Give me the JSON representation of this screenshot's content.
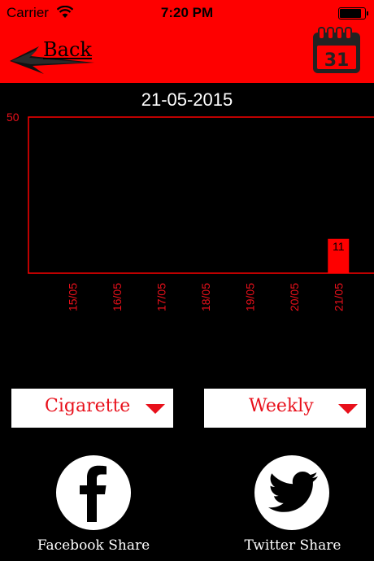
{
  "status_bar": {
    "carrier": "Carrier",
    "time": "7:20 PM"
  },
  "nav": {
    "back_label": "Back",
    "calendar_day": "31"
  },
  "colors": {
    "accent": "#fe0000",
    "bar": "#fe0000",
    "text_red": "#e8101b"
  },
  "chart_data": {
    "type": "bar",
    "title": "21-05-2015",
    "categories": [
      "15/05",
      "16/05",
      "17/05",
      "18/05",
      "19/05",
      "20/05",
      "21/05"
    ],
    "values": [
      0,
      0,
      0,
      0,
      0,
      0,
      11
    ],
    "data_labels": [
      "",
      "",
      "",
      "",
      "",
      "",
      "11"
    ],
    "ylim": [
      0,
      50
    ],
    "y_tick_labels": [
      "50"
    ],
    "xlabel": "",
    "ylabel": "",
    "grid": false
  },
  "filters": {
    "category_selected": "Cigarette",
    "period_selected": "Weekly"
  },
  "share": {
    "facebook_label": "Facebook Share",
    "twitter_label": "Twitter Share"
  }
}
